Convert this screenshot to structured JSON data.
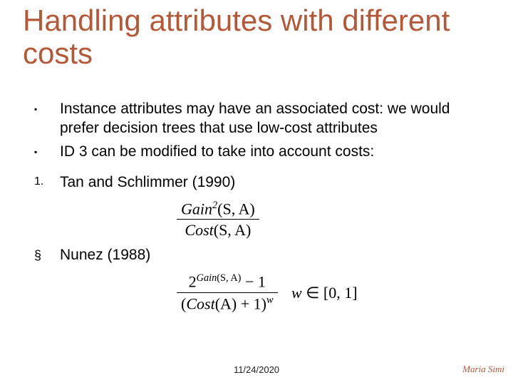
{
  "title": "Handling attributes with different costs",
  "bullets": {
    "b1": "Instance attributes may have an associated cost: we would prefer decision trees that use low-cost attributes",
    "b2": "ID 3 can be modified to take into account costs:",
    "n1": "Tan and Schlimmer   (1990)",
    "s1": "Nunez (1988)"
  },
  "markers": {
    "square": "▪",
    "num1": "1.",
    "section": "§"
  },
  "formula1": {
    "numerator_prefix": "Gain",
    "numerator_sup": "2",
    "numerator_args": "(S, A)",
    "denominator_prefix": "Cost",
    "denominator_args": "(S, A)"
  },
  "formula2": {
    "numerator_base": "2",
    "numerator_exp_prefix": "Gain",
    "numerator_exp_args": "(S, A)",
    "numerator_tail_minus": " − ",
    "numerator_tail_one": "1",
    "denominator_open": "(",
    "denominator_cost": "Cost",
    "denominator_args": "(A)",
    "denominator_plus_one_close": " + 1)",
    "denominator_exp": "w",
    "condition_var": "w",
    "condition_in": " ∈ ",
    "condition_range": "[0, 1]"
  },
  "footer": {
    "date": "11/24/2020",
    "author": "Maria Simi"
  }
}
